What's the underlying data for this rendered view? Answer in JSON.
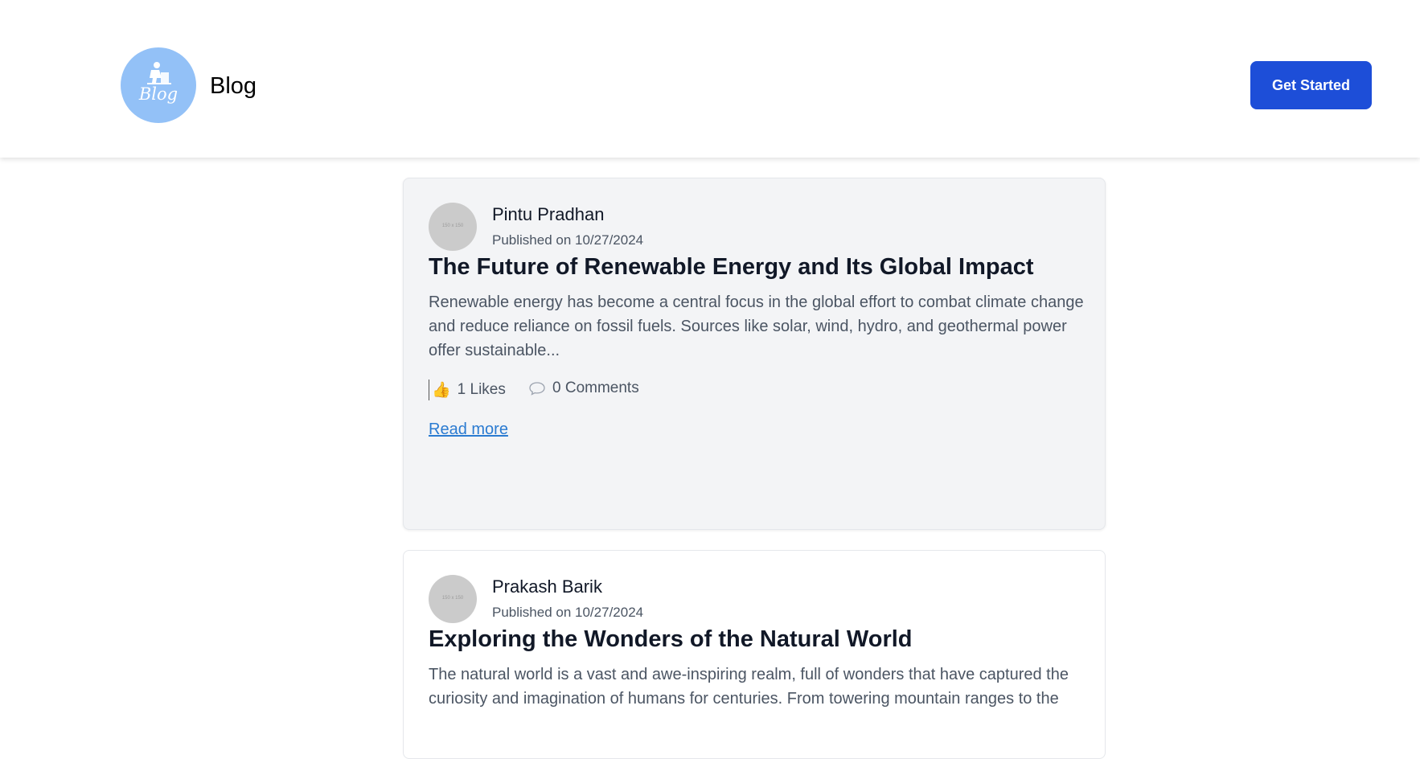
{
  "header": {
    "logo_text": "Blog",
    "brand": "Blog",
    "cta_label": "Get Started"
  },
  "posts": [
    {
      "author": "Pintu Pradhan",
      "avatar_text": "150 x 150",
      "date": "Published on 10/27/2024",
      "title": "The Future of Renewable Energy and Its Global Impact",
      "excerpt": "Renewable energy has become a central focus in the global effort to combat climate change and reduce reliance on fossil fuels. Sources like solar, wind, hydro, and geothermal power offer sustainable...",
      "likes": "1 Likes",
      "comments": "0 Comments",
      "read_more": "Read more"
    },
    {
      "author": "Prakash Barik",
      "avatar_text": "150 x 150",
      "date": "Published on 10/27/2024",
      "title": "Exploring the Wonders of the Natural World",
      "excerpt": "The natural world is a vast and awe-inspiring realm, full of wonders that have captured the curiosity and imagination of humans for centuries. From towering mountain ranges to the"
    }
  ],
  "icons": {
    "like": "thumbs-up-icon",
    "comment": "speech-bubble-icon"
  },
  "colors": {
    "accent": "#1d4ed8",
    "logo_bg": "#93c1f7",
    "link": "#2b7bd1",
    "card_bg": "#f3f4f6"
  }
}
